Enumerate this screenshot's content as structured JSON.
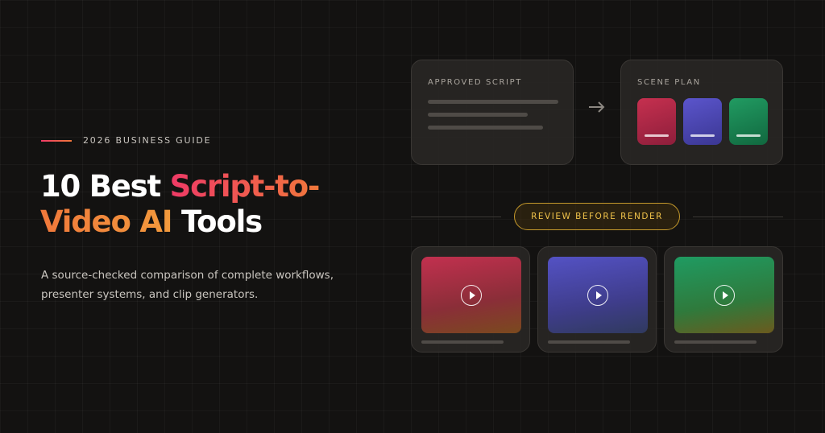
{
  "hero": {
    "eyebrow": "2026 BUSINESS GUIDE",
    "headline": {
      "part1": "10 Best ",
      "accent1": "Script-to-",
      "accent2": "Video AI",
      "part2": " Tools"
    },
    "subtitle": "A source-checked comparison of complete workflows, presenter systems, and clip generators."
  },
  "illustration": {
    "script_card": {
      "label": "APPROVED SCRIPT"
    },
    "scene_card": {
      "label": "SCENE PLAN",
      "tiles": [
        "red",
        "blue",
        "green"
      ]
    },
    "review_pill": "REVIEW BEFORE RENDER",
    "videos": [
      "red",
      "blue",
      "green"
    ],
    "icons": {
      "arrow": "arrow-right-icon",
      "play": "play-icon"
    }
  },
  "colors": {
    "background": "#131211",
    "accent_pink": "#ef3a66",
    "accent_orange": "#f0783b",
    "review_gold": "#f0c24a",
    "tile_red": "#c6304f",
    "tile_blue": "#5b55cc",
    "tile_green": "#219b62"
  }
}
